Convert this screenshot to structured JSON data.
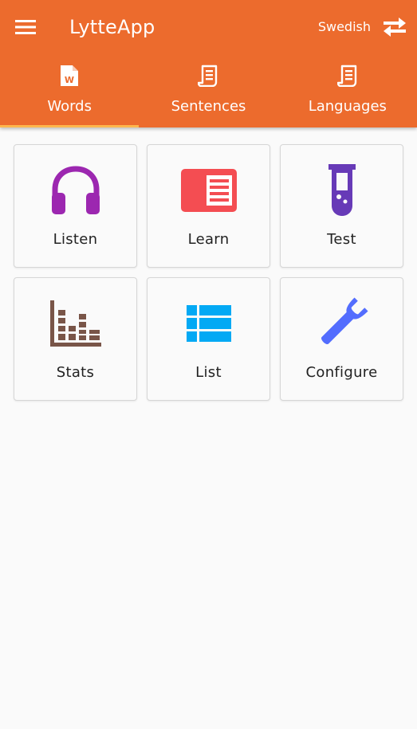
{
  "header": {
    "menu_icon": "hamburger-menu-icon",
    "title": "LytteApp",
    "language": "Swedish",
    "swap_icon": "swap-arrows-icon",
    "background_color": "#ec6b2d"
  },
  "tabs": [
    {
      "label": "Words",
      "icon": "word-document-icon",
      "active": true
    },
    {
      "label": "Sentences",
      "icon": "script-icon",
      "active": false
    },
    {
      "label": "Languages",
      "icon": "script-icon",
      "active": false
    }
  ],
  "actions": [
    {
      "label": "Listen",
      "icon": "headphones-icon",
      "color": "#9c27b0"
    },
    {
      "label": "Learn",
      "icon": "reader-icon",
      "color": "#f44d52"
    },
    {
      "label": "Test",
      "icon": "test-tube-icon",
      "color": "#673ab7"
    },
    {
      "label": "Stats",
      "icon": "bar-chart-icon",
      "color": "#795548"
    },
    {
      "label": "List",
      "icon": "list-icon",
      "color": "#03a9f4"
    },
    {
      "label": "Configure",
      "icon": "wrench-icon",
      "color": "#536dfe"
    }
  ]
}
